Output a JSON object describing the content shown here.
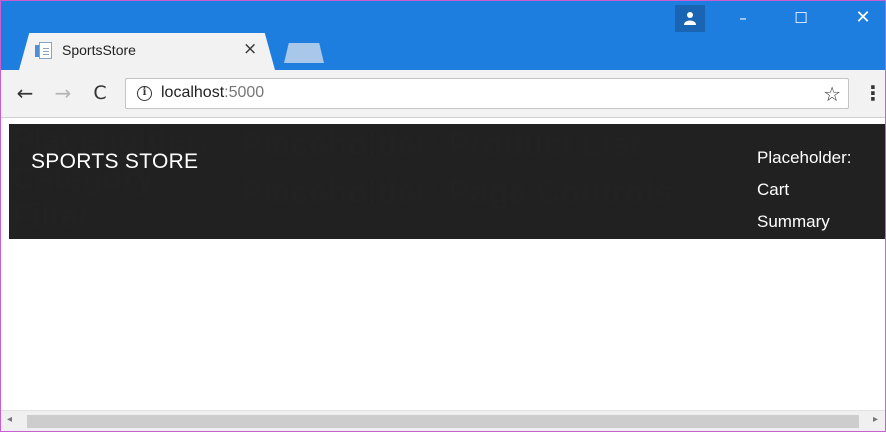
{
  "browser": {
    "tab_title": "SportsStore",
    "tab_close": "×",
    "url_host": "localhost",
    "url_port": ":5000",
    "window_controls": {
      "minimize": "–",
      "maximize": "☐",
      "close": "✕"
    },
    "nav": {
      "back": "←",
      "forward": "→",
      "reload": "C"
    },
    "icons": {
      "info": "i",
      "star": "☆",
      "menu": "⋮"
    }
  },
  "page": {
    "brand": "SPORTS STORE",
    "cart_summary": [
      "Placeholder:",
      "Cart",
      "Summary"
    ],
    "category_filter": [
      "Placeholder:",
      "Category",
      "Filter"
    ],
    "product_list": "Placeholder: Product List",
    "page_controls": "Placeholder: Page Controls"
  },
  "scrollbar": {
    "left_arrow": "◂",
    "right_arrow": "▸"
  },
  "colors": {
    "titlebar": "#1e7ee0",
    "navbar": "#212121",
    "window_border": "#c95fd2"
  }
}
